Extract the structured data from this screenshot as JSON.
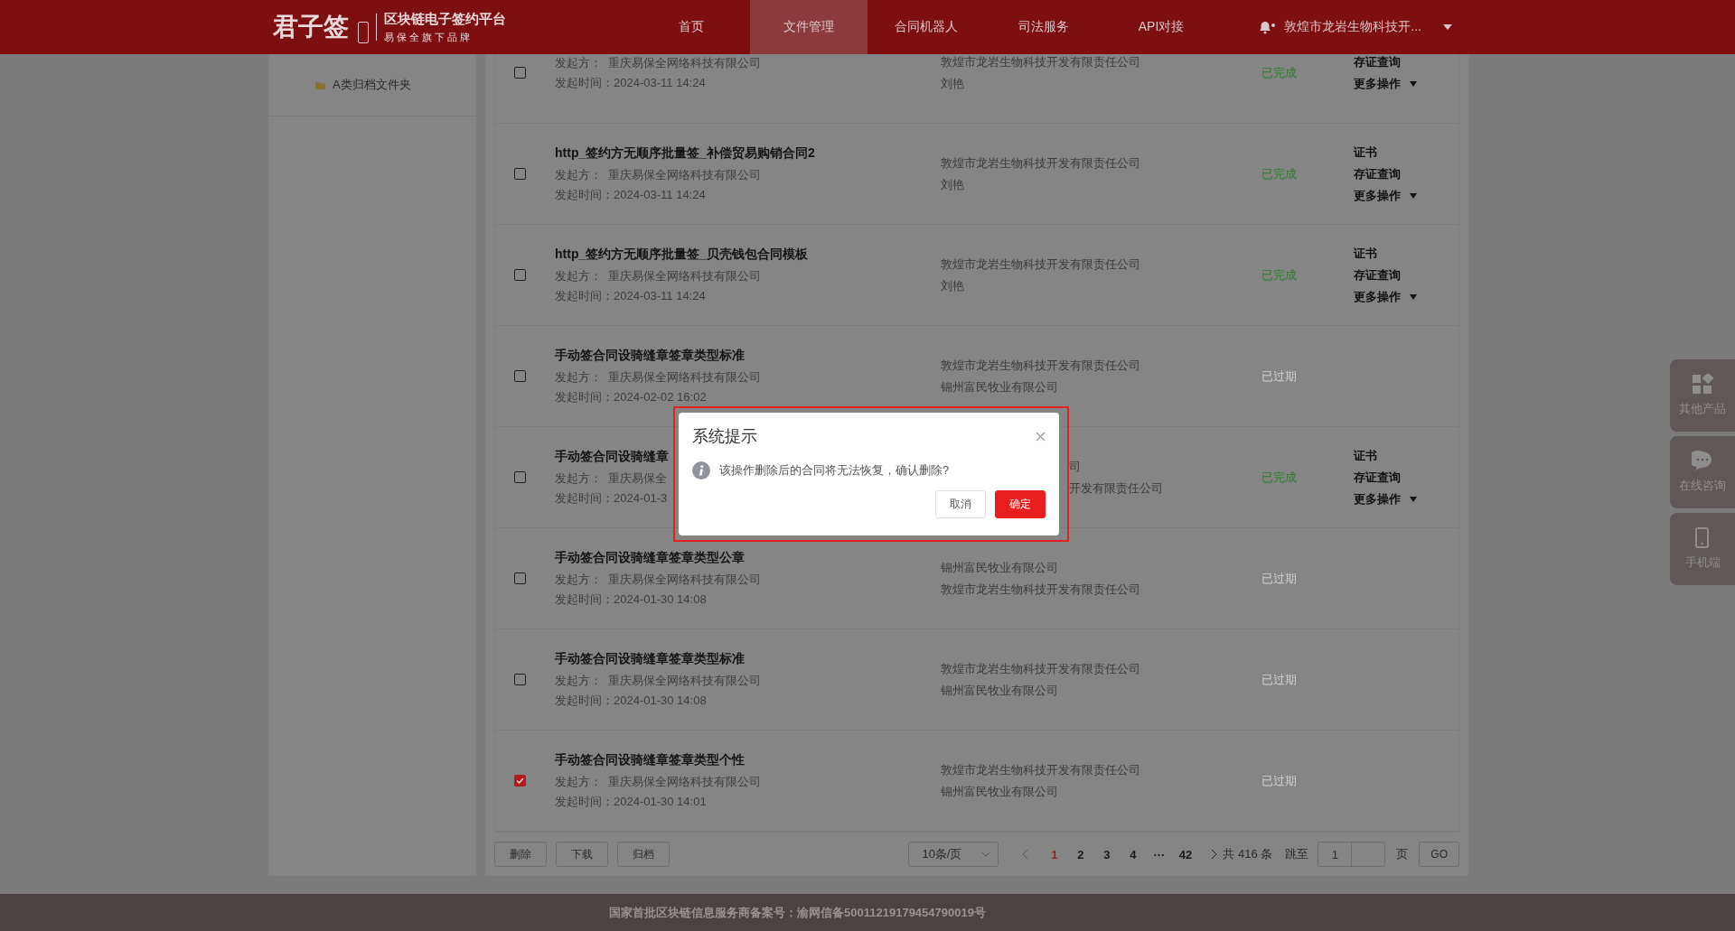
{
  "header": {
    "logo_mark": "君子签",
    "logo_title": "区块链电子签约平台",
    "logo_slogan": "易 保 全 旗 下 品 牌",
    "nav": [
      {
        "label": "首页",
        "selected": false
      },
      {
        "label": "文件管理",
        "selected": true
      },
      {
        "label": "合同机器人",
        "selected": false
      },
      {
        "label": "司法服务",
        "selected": false
      },
      {
        "label": "API对接",
        "selected": false
      }
    ],
    "notification_dot": true,
    "user": "敦煌市龙岩生物科技开..."
  },
  "sidebar": {
    "folders": [
      {
        "label": "A类归档文件夹"
      }
    ]
  },
  "contracts": [
    {
      "checked": false,
      "covered": false,
      "sender": "发起方：  重庆易保全网络科技有限公司",
      "time": "发起时间：2024-03-11 14:24",
      "parties": [
        "敦煌市龙岩生物科技开发有限责任公司",
        "刘艳"
      ],
      "status": "已完成",
      "color": "#2e7d2e",
      "actions": [
        {
          "label": "存证查询",
          "kind": "link"
        },
        {
          "label": "更多操作",
          "kind": "menu"
        }
      ]
    },
    {
      "checked": false,
      "covered": false,
      "title": "http_签约方无顺序批量签_补偿贸易购销合同2",
      "sender": "发起方：  重庆易保全网络科技有限公司",
      "time": "发起时间：2024-03-11 14:24",
      "parties": [
        "敦煌市龙岩生物科技开发有限责任公司",
        "刘艳"
      ],
      "status": "已完成",
      "color": "#2e7d2e",
      "actions": [
        {
          "label": "证书",
          "kind": "link"
        },
        {
          "label": "存证查询",
          "kind": "link"
        },
        {
          "label": "更多操作",
          "kind": "menu"
        }
      ]
    },
    {
      "checked": false,
      "covered": false,
      "title": "http_签约方无顺序批量签_贝壳钱包合同模板",
      "sender": "发起方：  重庆易保全网络科技有限公司",
      "time": "发起时间：2024-03-11 14:24",
      "parties": [
        "敦煌市龙岩生物科技开发有限责任公司",
        "刘艳"
      ],
      "status": "已完成",
      "color": "#2e7d2e",
      "actions": [
        {
          "label": "证书",
          "kind": "link"
        },
        {
          "label": "存证查询",
          "kind": "link"
        },
        {
          "label": "更多操作",
          "kind": "menu"
        }
      ]
    },
    {
      "checked": false,
      "covered": false,
      "title": "手动签合同设骑缝章签章类型标准",
      "sender": "发起方：  重庆易保全网络科技有限公司",
      "time": "发起时间：2024-02-02 16:02",
      "parties": [
        "敦煌市龙岩生物科技开发有限责任公司",
        "锦州富民牧业有限公司"
      ],
      "status": "已过期",
      "color": "#cfcfcf"
    },
    {
      "checked": false,
      "covered": true,
      "title": "手动签合同设骑缝章",
      "sender": "发起方：  重庆易保全",
      "time": "发起时间：2024-01-3",
      "parties": [
        "司",
        "开发有限责任公司"
      ],
      "status": "已完成",
      "color": "#2e7d2e",
      "actions": [
        {
          "label": "证书",
          "kind": "link"
        },
        {
          "label": "存证查询",
          "kind": "link"
        },
        {
          "label": "更多操作",
          "kind": "menu"
        }
      ]
    },
    {
      "checked": false,
      "covered": false,
      "title": "手动签合同设骑缝章签章类型公章",
      "sender": "发起方：  重庆易保全网络科技有限公司",
      "time": "发起时间：2024-01-30 14:08",
      "parties": [
        "锦州富民牧业有限公司",
        "敦煌市龙岩生物科技开发有限责任公司"
      ],
      "status": "已过期",
      "color": "#cfcfcf"
    },
    {
      "checked": false,
      "covered": false,
      "title": "手动签合同设骑缝章签章类型标准",
      "sender": "发起方：  重庆易保全网络科技有限公司",
      "time": "发起时间：2024-01-30 14:08",
      "parties": [
        "敦煌市龙岩生物科技开发有限责任公司",
        "锦州富民牧业有限公司"
      ],
      "status": "已过期",
      "color": "#cfcfcf"
    },
    {
      "checked": true,
      "covered": false,
      "title": "手动签合同设骑缝章签章类型个性",
      "sender": "发起方：  重庆易保全网络科技有限公司",
      "time": "发起时间：2024-01-30 14:01",
      "parties": [
        "敦煌市龙岩生物科技开发有限责任公司",
        "锦州富民牧业有限公司"
      ],
      "status": "已过期",
      "color": "#cfcfcf"
    }
  ],
  "pager": {
    "buttons": [
      "删除",
      "下载",
      "归档"
    ],
    "page_size": "10条/页",
    "pages": [
      {
        "label": "1",
        "selected": true
      },
      {
        "label": "2",
        "selected": false
      },
      {
        "label": "3",
        "selected": false
      },
      {
        "label": "4",
        "selected": false
      },
      {
        "label": "···",
        "selected": false
      },
      {
        "label": "42",
        "selected": false
      }
    ],
    "total": "共 416 条",
    "jump_label": "跳至",
    "jump_value": "1",
    "page_unit": "页",
    "go": "GO"
  },
  "side_tools": [
    {
      "label": "其他产品",
      "kind": "apps"
    },
    {
      "label": "在线咨询",
      "kind": "chat"
    },
    {
      "label": "手机端",
      "kind": "phone"
    }
  ],
  "dialog": {
    "title": "系统提示",
    "message": "该操作删除后的合同将无法恢复，确认删除?",
    "buttons": [
      {
        "label": "取消",
        "kind": "secondary"
      },
      {
        "label": "确定",
        "kind": "primary"
      }
    ]
  },
  "footer": {
    "text": "国家首批区块链信息服务商备案号：渝网信备50011219179454790019号"
  }
}
